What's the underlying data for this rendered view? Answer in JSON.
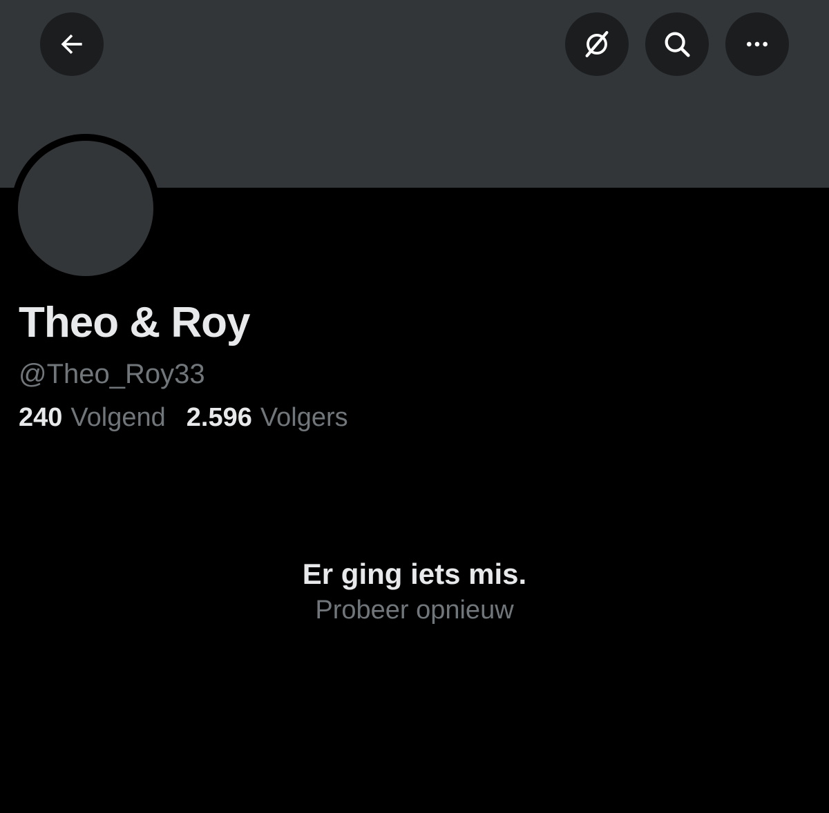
{
  "header": {
    "back_icon": "arrow-left-icon",
    "grok_icon": "grok-icon",
    "search_icon": "search-icon",
    "more_icon": "more-horizontal-icon"
  },
  "colors": {
    "background": "#000000",
    "banner": "#333639",
    "button_bg": "#1b1d1f",
    "primary_text": "#e7e9ea",
    "secondary_text": "#71767b"
  },
  "profile": {
    "display_name": "Theo & Roy",
    "handle": "@Theo_Roy33",
    "following_count": "240",
    "following_label": "Volgend",
    "followers_count": "2.596",
    "followers_label": "Volgers"
  },
  "error": {
    "title": "Er ging iets mis.",
    "retry": "Probeer opnieuw"
  }
}
